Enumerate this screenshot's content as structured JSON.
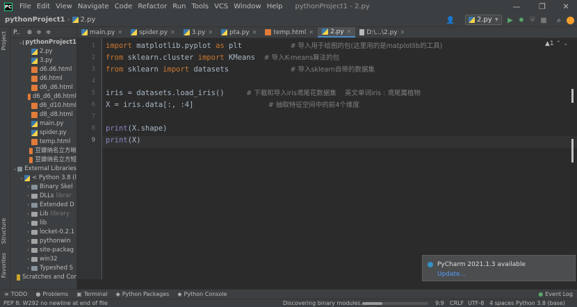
{
  "menubar": {
    "items": [
      "File",
      "Edit",
      "View",
      "Navigate",
      "Code",
      "Refactor",
      "Run",
      "Tools",
      "VCS",
      "Window",
      "Help"
    ],
    "window_title": "pythonProject1 - 2.py"
  },
  "nav": {
    "project": "pythonProject1",
    "file": "2.py"
  },
  "run_config": "2.py",
  "project_panel": {
    "header": "P..",
    "tree": [
      {
        "label": "pythonProject1",
        "type": "folder",
        "level": 1,
        "expanded": true,
        "bold": true
      },
      {
        "label": "2.py",
        "type": "py",
        "level": 2
      },
      {
        "label": "3.py",
        "type": "py",
        "level": 2
      },
      {
        "label": "d6.d6.html",
        "type": "html",
        "level": 2
      },
      {
        "label": "d6.html",
        "type": "html",
        "level": 2
      },
      {
        "label": "d6_d6.html",
        "type": "html",
        "level": 2
      },
      {
        "label": "d6_d6_d6.html",
        "type": "html",
        "level": 2
      },
      {
        "label": "d6_d10.html",
        "type": "html",
        "level": 2
      },
      {
        "label": "d8_d8.html",
        "type": "html",
        "level": 2
      },
      {
        "label": "main.py",
        "type": "py",
        "level": 2
      },
      {
        "label": "spider.py",
        "type": "py",
        "level": 2
      },
      {
        "label": "temp.html",
        "type": "html",
        "level": 2
      },
      {
        "label": "豆瓣纳名立方晰",
        "type": "html",
        "level": 2
      },
      {
        "label": "豆瓣纳名立方短",
        "type": "html",
        "level": 2
      },
      {
        "label": "External Libraries",
        "type": "lib",
        "level": 0,
        "expanded": true
      },
      {
        "label": "< Python 3.8 (l",
        "type": "py",
        "level": 1,
        "expanded": true
      },
      {
        "label": "Binary Skel",
        "type": "lib",
        "level": 2,
        "collapsed": true
      },
      {
        "label": "DLLs",
        "type": "folder",
        "level": 2,
        "collapsed": true,
        "suffix": "librar"
      },
      {
        "label": "Extended D",
        "type": "lib",
        "level": 2,
        "collapsed": true
      },
      {
        "label": "Lib",
        "type": "folder",
        "level": 2,
        "collapsed": true,
        "suffix": "library"
      },
      {
        "label": "lib",
        "type": "folder",
        "level": 2,
        "collapsed": true
      },
      {
        "label": "locket-0.2.1",
        "type": "folder",
        "level": 2,
        "collapsed": true
      },
      {
        "label": "pythonwin",
        "type": "folder",
        "level": 2,
        "collapsed": true
      },
      {
        "label": "site-packag",
        "type": "folder",
        "level": 2,
        "collapsed": true
      },
      {
        "label": "win32",
        "type": "folder",
        "level": 2,
        "collapsed": true
      },
      {
        "label": "Typeshed S",
        "type": "lib",
        "level": 2,
        "collapsed": true
      },
      {
        "label": "Scratches and Cor",
        "type": "star",
        "level": 0
      }
    ]
  },
  "tabs": [
    {
      "label": "main.py",
      "type": "py"
    },
    {
      "label": "spider.py",
      "type": "py"
    },
    {
      "label": "3.py",
      "type": "py"
    },
    {
      "label": "pta.py",
      "type": "py"
    },
    {
      "label": "temp.html",
      "type": "html"
    },
    {
      "label": "2.py",
      "type": "py",
      "active": true
    },
    {
      "label": "D:\\...\\2.py",
      "type": "file"
    }
  ],
  "code_lines": [
    {
      "n": "1",
      "parts": [
        [
          "kw",
          "import"
        ],
        [
          "",
          "matplotlib.pyplot "
        ],
        [
          "kw",
          "as"
        ],
        [
          "",
          "plt           "
        ],
        [
          "cm",
          "# 导入用于绘图的包(这里用的是matplotlib的工具)"
        ]
      ]
    },
    {
      "n": "2",
      "parts": [
        [
          "kw",
          "from"
        ],
        [
          "",
          "sklearn.cluster "
        ],
        [
          "kw",
          "import"
        ],
        [
          "",
          "KMeans  "
        ],
        [
          "cm",
          "# 导入K-means算法的包"
        ]
      ]
    },
    {
      "n": "3",
      "parts": [
        [
          "kw",
          "from"
        ],
        [
          "",
          "sklearn "
        ],
        [
          "kw",
          "import"
        ],
        [
          "",
          "datasets              "
        ],
        [
          "cm",
          "# 导入sklearn自带的数据集"
        ]
      ]
    },
    {
      "n": "4",
      "parts": []
    },
    {
      "n": "5",
      "parts": [
        [
          "",
          "iris = datasets.load_iris()     "
        ],
        [
          "cm",
          "# 下载和导入iris鸢尾花数据集    英文单词iris : 鸢尾属植物"
        ]
      ]
    },
    {
      "n": "6",
      "parts": [
        [
          "",
          "X = iris.data[:, :4]                 "
        ],
        [
          "cm",
          "# 抽取特征空间中的前4个维度"
        ]
      ]
    },
    {
      "n": "7",
      "parts": []
    },
    {
      "n": "8",
      "parts": [
        [
          "fn",
          "print"
        ],
        [
          "",
          "(X.shape)"
        ]
      ]
    },
    {
      "n": "9",
      "parts": [
        [
          "fn",
          "print"
        ],
        [
          "",
          "(X)"
        ]
      ]
    }
  ],
  "warning_indicator": "▲1",
  "notification": {
    "title": "PyCharm 2021.1.3 available",
    "link": "Update..."
  },
  "bottom_tools": [
    {
      "icon": "≡",
      "label": "TODO"
    },
    {
      "icon": "●",
      "label": "Problems"
    },
    {
      "icon": "▣",
      "label": "Terminal"
    },
    {
      "icon": "◆",
      "label": "Python Packages"
    },
    {
      "icon": "◆",
      "label": "Python Console"
    }
  ],
  "event_log": "Event Log",
  "status": {
    "message": "PEP 8: W292 no newline at end of file",
    "task": "Discovering binary modules...",
    "position": "9:9",
    "line_sep": "CRLF",
    "encoding": "UTF-8",
    "indent": "4 spaces",
    "interpreter": "Python 3.8 (base)"
  },
  "colors": {
    "accent": "#4a88c7",
    "background": "#2b2b2b",
    "panel": "#3c3f41",
    "keyword": "#cc7832",
    "comment": "#808080"
  }
}
